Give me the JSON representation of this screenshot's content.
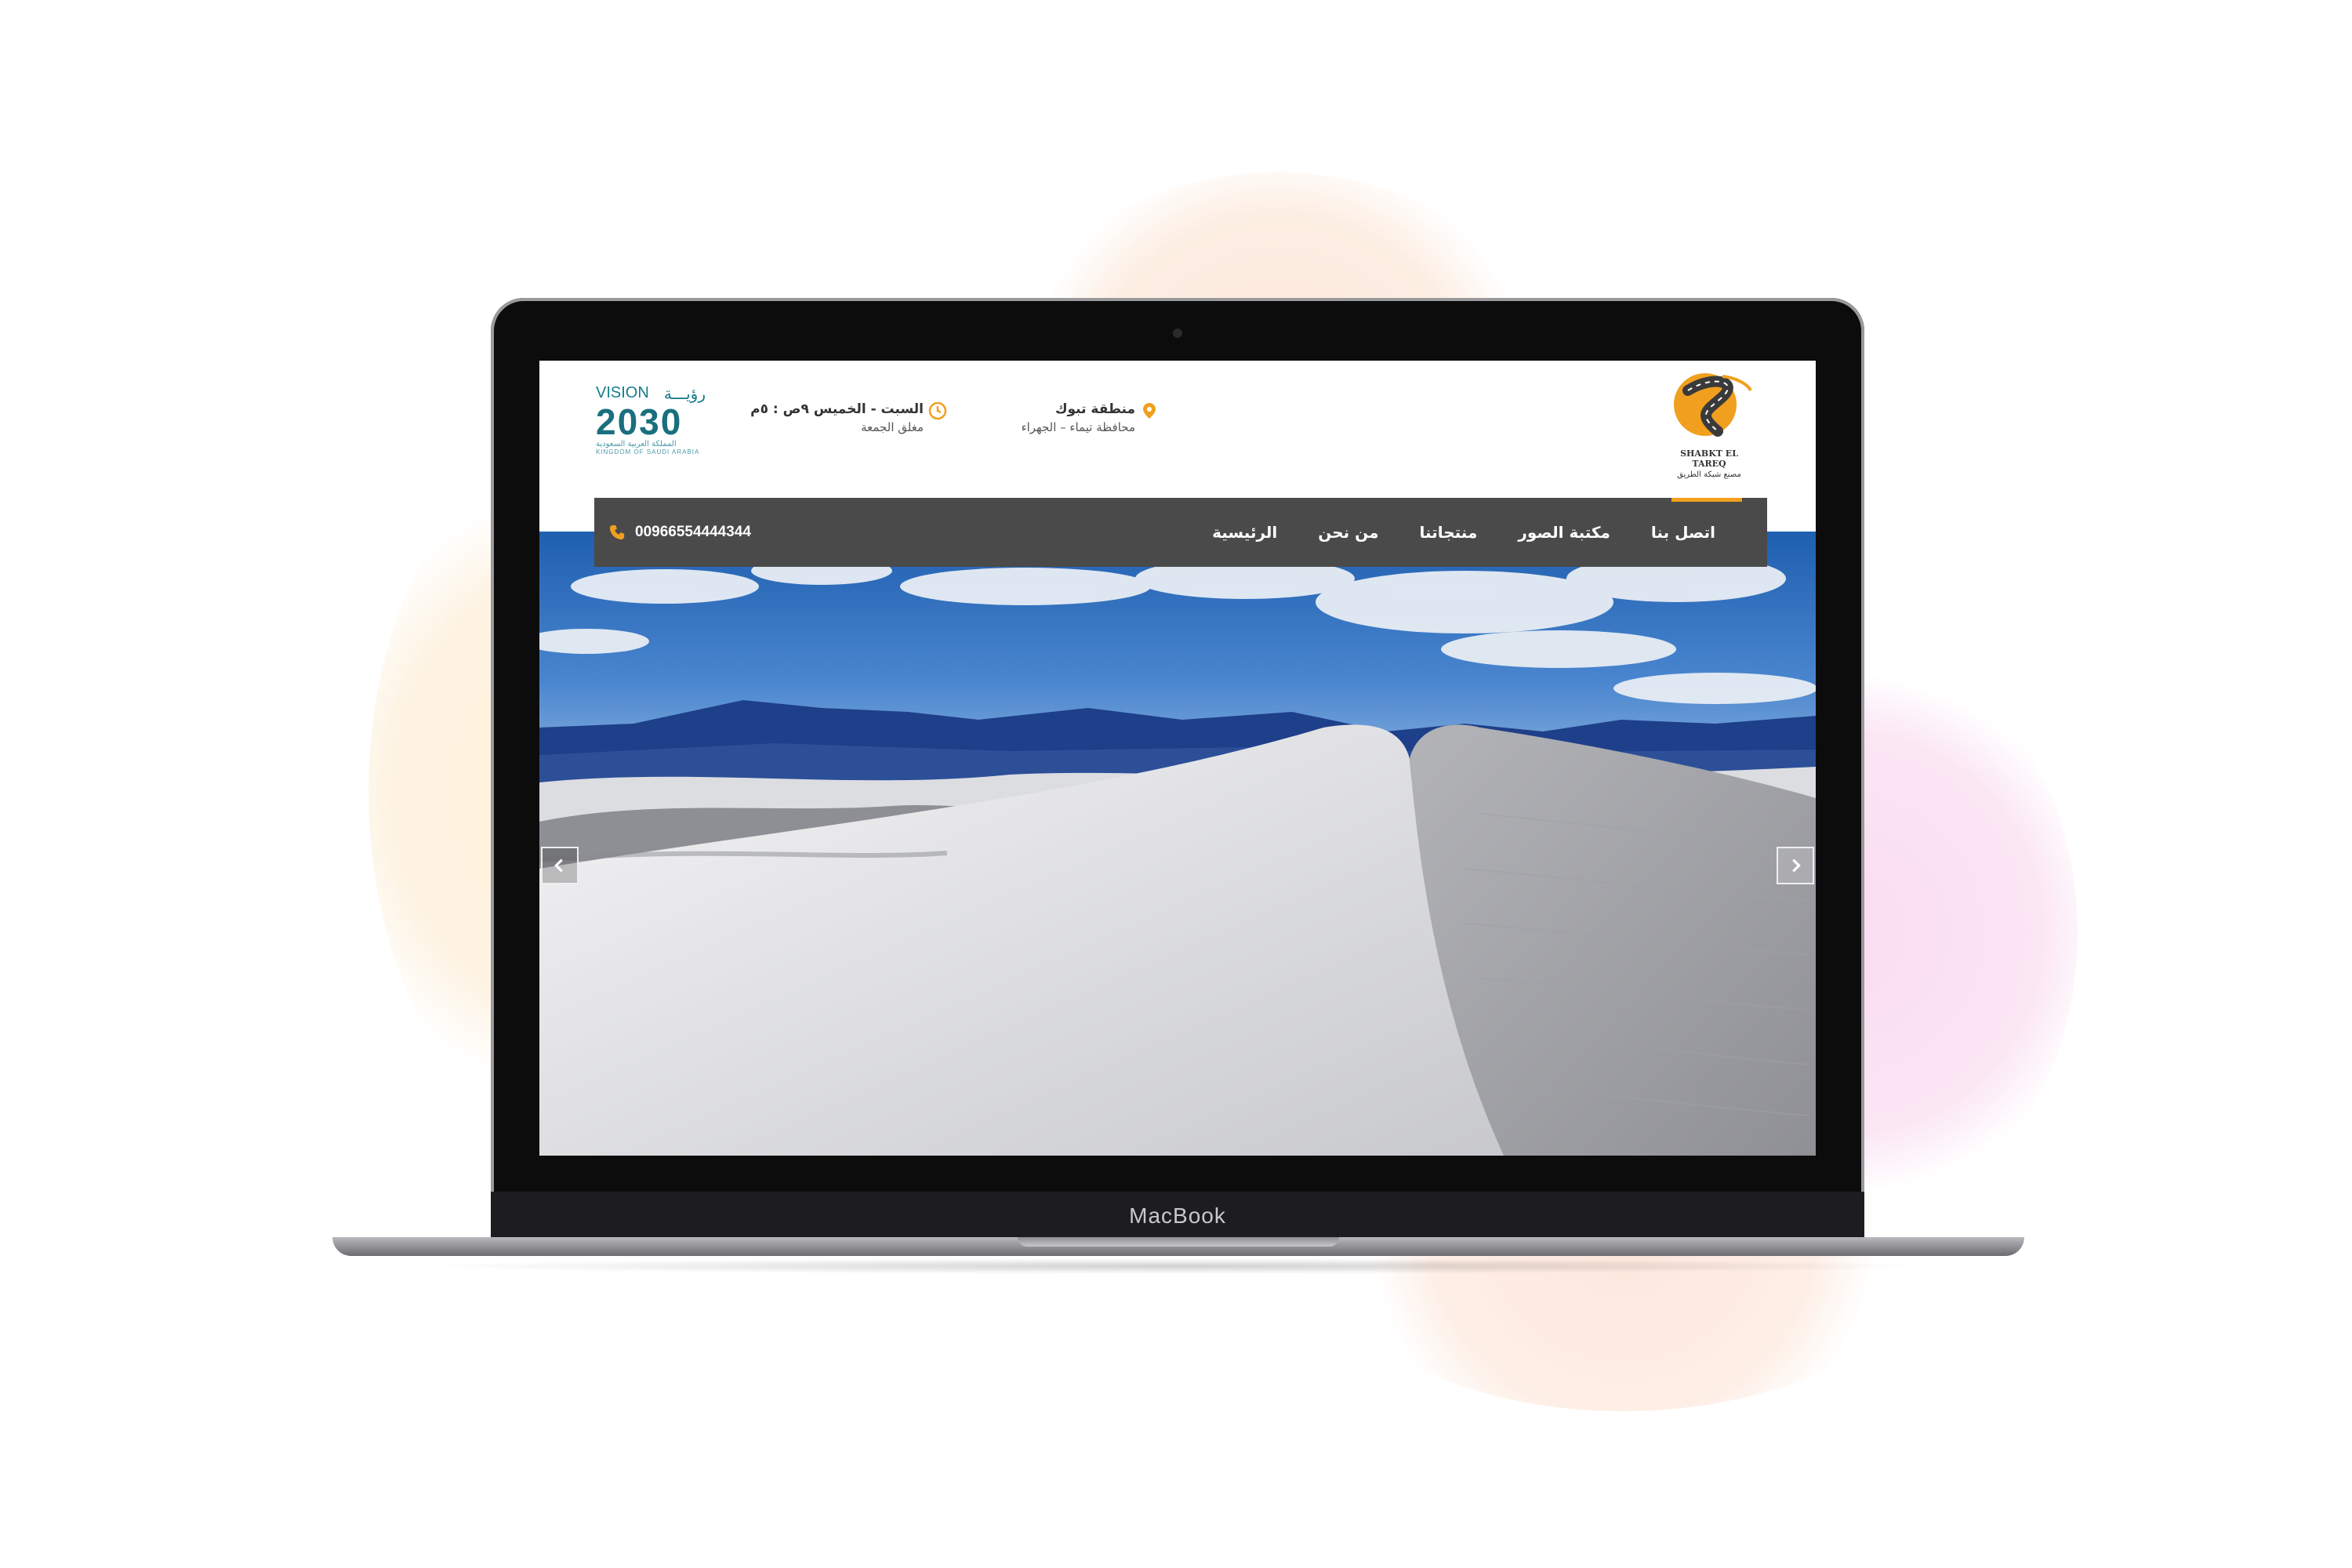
{
  "device": {
    "brand_label": "MacBook"
  },
  "site": {
    "logo": {
      "name_en": "SHABKT EL TAREQ",
      "name_ar": "مصنع شبكة الطريق"
    },
    "location": {
      "title": "منطقة تبوك",
      "subtitle": "محافظة تيماء – الجهراء"
    },
    "hours": {
      "title": "السبت - الخميس ٩ص : ٥م",
      "subtitle": "مغلق الجمعة"
    },
    "vision": {
      "label_en": "VISION",
      "label_ar": "رؤيـــة",
      "number": "2030",
      "sub_ar": "المملكة العربية السعودية",
      "sub_en": "KINGDOM OF SAUDI ARABIA"
    },
    "nav": {
      "items": [
        "الرئيسية",
        "من نحن",
        "منتجاتنا",
        "مكتبة الصور",
        "اتصل بنا"
      ],
      "active_index": 0,
      "phone": "00966554444344"
    },
    "colors": {
      "accent": "#f0a01e",
      "nav_bg": "#4a4a4a",
      "vision_teal": "#1a6f7e"
    },
    "slider": {
      "prev_icon": "chevron-left-icon",
      "next_icon": "chevron-right-icon"
    }
  }
}
